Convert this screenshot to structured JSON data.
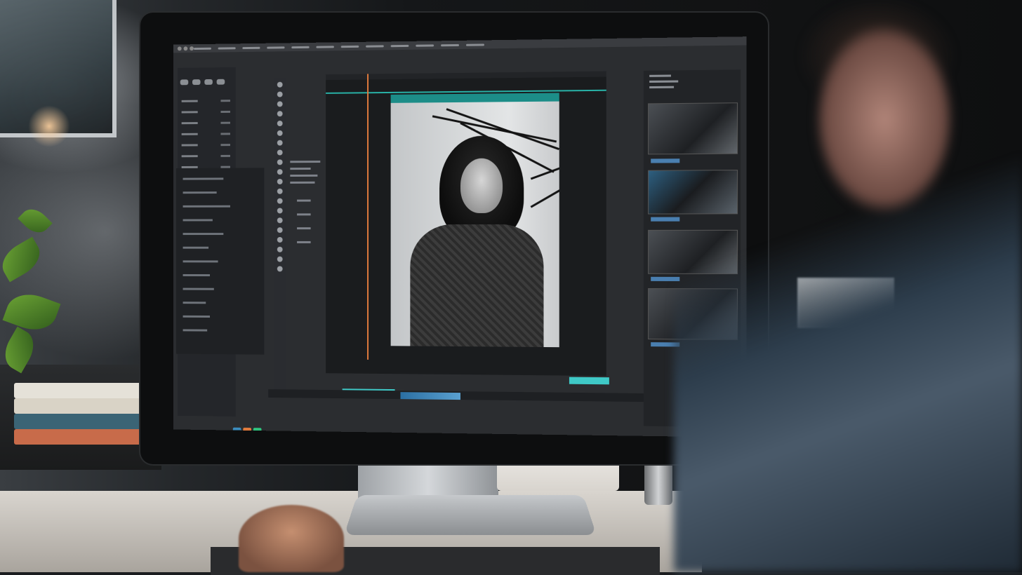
{
  "scene": {
    "subject": "photo-editing-workstation",
    "accent_colors": {
      "timeline_cyan": "#3fc9c7",
      "playhead_orange": "#e07a3c",
      "panel_dark": "#24262a"
    }
  },
  "swatches": [
    "#3c8dbf",
    "#e07a3c",
    "#2ec27e",
    "#4aa3df",
    "#2a7f8c",
    "#24b36a"
  ]
}
